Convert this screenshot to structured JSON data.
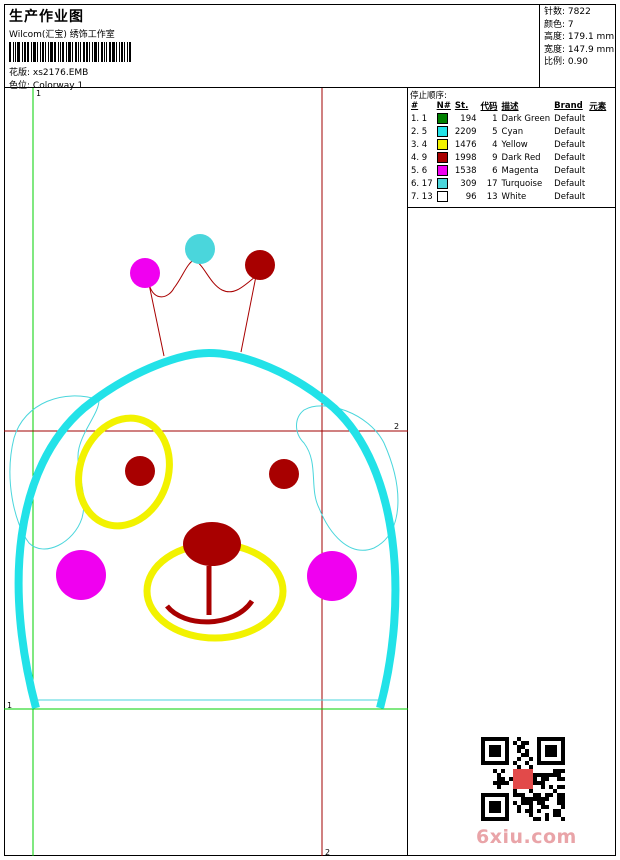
{
  "header": {
    "title": "生产作业图",
    "vendor": "Wilcom(汇宝) 绣饰工作室",
    "pattern_label": "花版:",
    "pattern_value": "xs2176.EMB",
    "colorway_label": "色位:",
    "colorway_value": "Colorway 1"
  },
  "stats": [
    {
      "label": "针数:",
      "value": "7822"
    },
    {
      "label": "颜色:",
      "value": "7"
    },
    {
      "label": "高度:",
      "value": "179.1 mm"
    },
    {
      "label": "宽度:",
      "value": "147.9 mm"
    },
    {
      "label": "比例:",
      "value": "0.90"
    }
  ],
  "stop_sequence": {
    "title": "停止顺序:",
    "columns": [
      "#",
      "N#",
      "St.",
      "代码",
      "描述",
      "Brand",
      "元素"
    ],
    "rows": [
      {
        "seq": "1. 1",
        "color": "#008000",
        "st": "194",
        "code": "1",
        "desc": "Dark Green",
        "brand": "Default"
      },
      {
        "seq": "2. 5",
        "color": "#22e2e8",
        "st": "2209",
        "code": "5",
        "desc": "Cyan",
        "brand": "Default"
      },
      {
        "seq": "3. 4",
        "color": "#f2f200",
        "st": "1476",
        "code": "4",
        "desc": "Yellow",
        "brand": "Default"
      },
      {
        "seq": "4. 9",
        "color": "#a80000",
        "st": "1998",
        "code": "9",
        "desc": "Dark Red",
        "brand": "Default"
      },
      {
        "seq": "5. 6",
        "color": "#f000f0",
        "st": "1538",
        "code": "6",
        "desc": "Magenta",
        "brand": "Default"
      },
      {
        "seq": "6. 17",
        "color": "#4ad6dc",
        "st": "309",
        "code": "17",
        "desc": "Turquoise",
        "brand": "Default"
      },
      {
        "seq": "7. 13",
        "color": "#ffffff",
        "st": "96",
        "code": "13",
        "desc": "White",
        "brand": "Default"
      }
    ]
  },
  "guides": {
    "label_v1": "1",
    "label_h1": "1",
    "label_h2": "2",
    "label_v2": "2"
  },
  "watermark": {
    "site": "6xiu.com"
  },
  "colors": {
    "cyan": "#22e2e8",
    "turquoise": "#4ad6dc",
    "yellow": "#f2f200",
    "dark_red": "#a80000",
    "magenta": "#f000f0",
    "guide_green": "#00d000",
    "guide_red": "#a00000"
  }
}
